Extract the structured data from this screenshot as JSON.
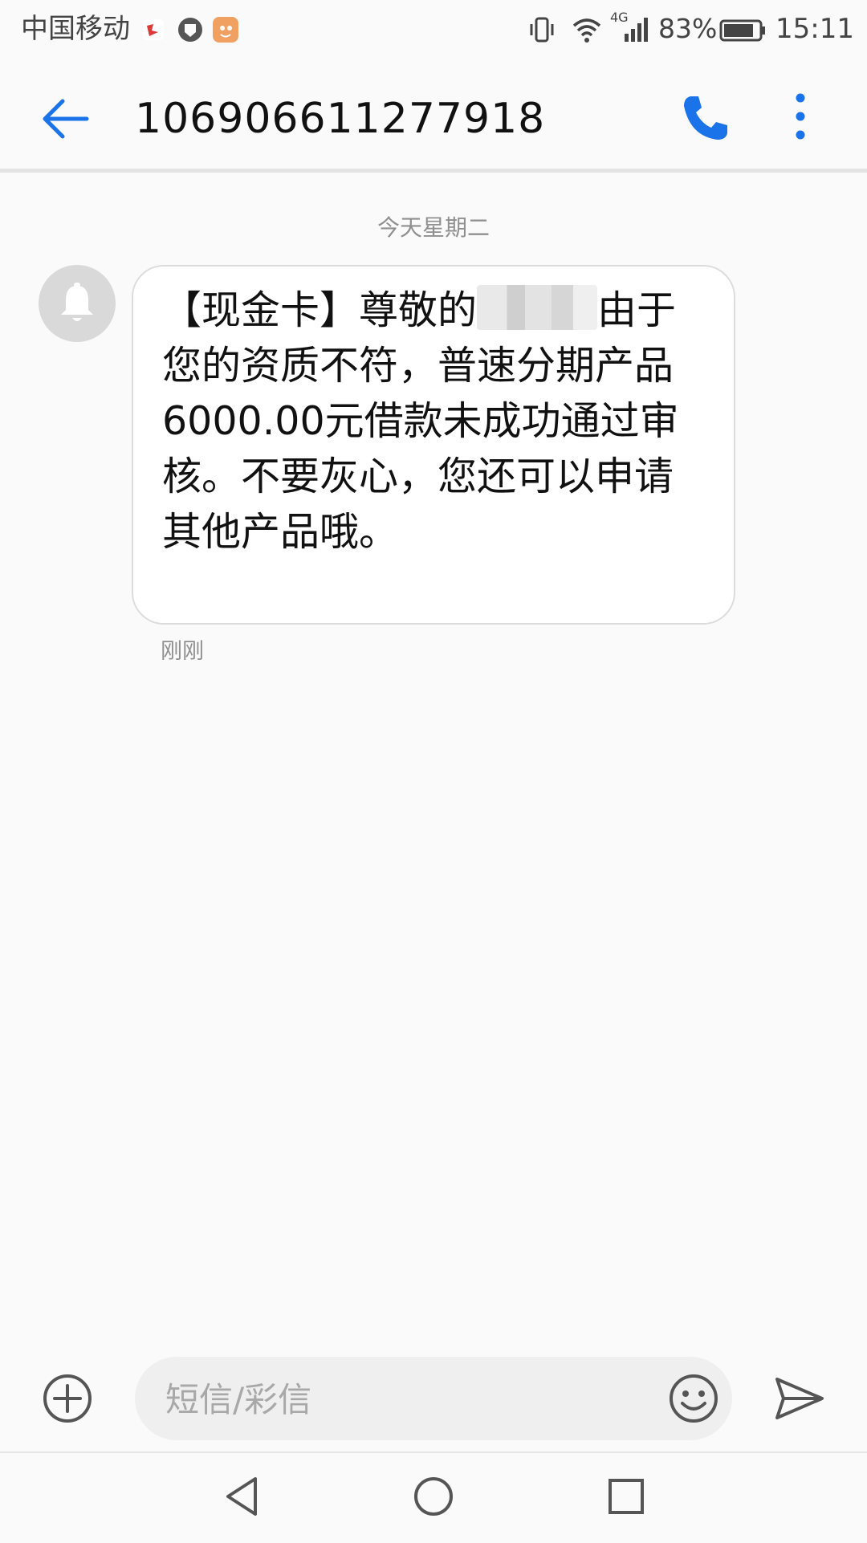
{
  "status_bar": {
    "carrier": "中国移动",
    "network": "4G",
    "battery": "83%",
    "time": "15:11"
  },
  "header": {
    "title": "106906611277918"
  },
  "conversation": {
    "date_separator": "今天星期二",
    "message": {
      "text_before_mask": "【现金卡】尊敬的",
      "text_after_mask": "由于您的资质不符，普速分期产品6000.00元借款未成功通过审核。不要灰心，您还可以申请其他产品哦。",
      "time": "刚刚"
    }
  },
  "composer": {
    "placeholder": "短信/彩信"
  },
  "icons": {
    "back": "arrow-left-icon",
    "call": "phone-icon",
    "more": "more-vertical-icon",
    "avatar": "bell-icon",
    "add": "add-circle-icon",
    "emoji": "smiley-icon",
    "send": "send-icon"
  },
  "colors": {
    "accent": "#1a73e8",
    "bubble_border": "#dcdcdc",
    "secondary_text": "#8f8f8f",
    "background": "#fafafa"
  }
}
